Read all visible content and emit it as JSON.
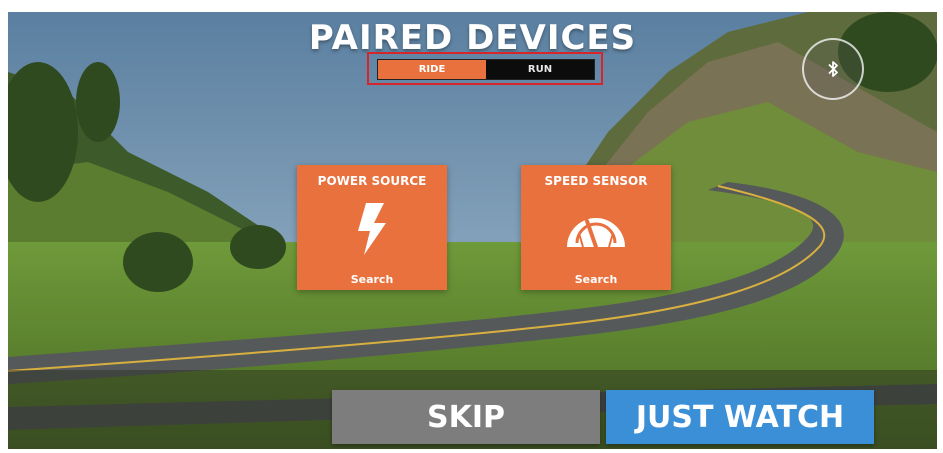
{
  "header": {
    "title": "PAIRED DEVICES"
  },
  "mode_toggle": {
    "options": [
      "RIDE",
      "RUN"
    ],
    "selected": "RIDE"
  },
  "bluetooth": {
    "icon": "bluetooth-icon"
  },
  "devices": [
    {
      "title": "POWER SOURCE",
      "icon": "lightning-bolt-icon",
      "action": "Search"
    },
    {
      "title": "SPEED SENSOR",
      "icon": "speedometer-icon",
      "action": "Search"
    }
  ],
  "footer": {
    "skip_label": "SKIP",
    "watch_label": "JUST WATCH"
  },
  "colors": {
    "accent": "#e8713e",
    "skip": "#7d7d7d",
    "watch": "#3b8fd6",
    "highlight": "#d6262a"
  }
}
